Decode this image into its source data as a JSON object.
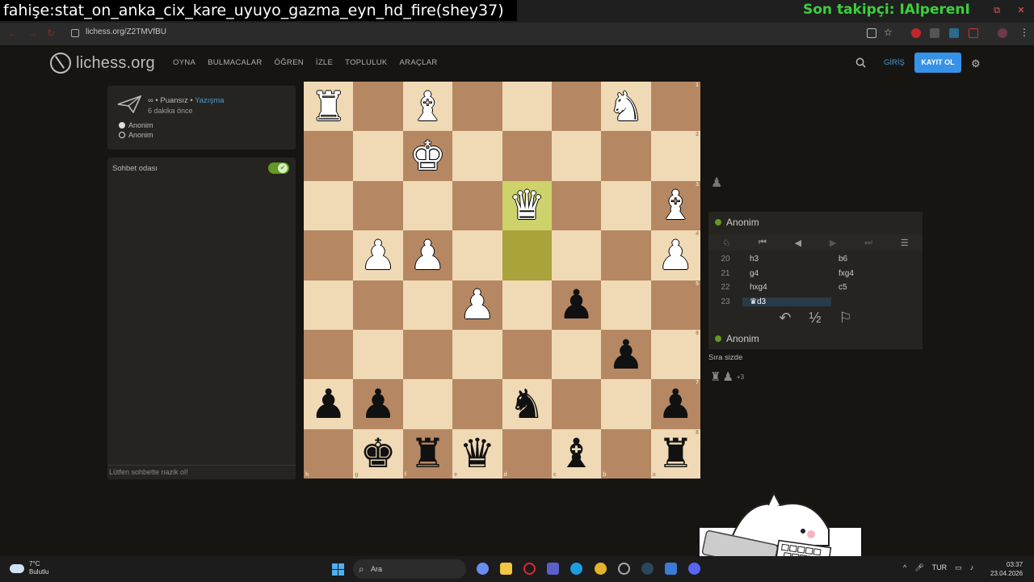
{
  "overlay": {
    "title": "fahişe:stat_on_anka_cix_kare_uyuyo_gazma_eyn_hd_fire(shey37)",
    "follower": "Son takipçi: IAlperenI"
  },
  "browser": {
    "url": "lichess.org/Z2TMVfBU"
  },
  "site": {
    "logo": "lichess.org",
    "nav": [
      "OYNA",
      "BULMACALAR",
      "ÖĞREN",
      "İZLE",
      "TOPLULUK",
      "ARAÇLAR"
    ],
    "login": "GİRİŞ",
    "register": "KAYIT OL"
  },
  "game_info": {
    "mode_prefix": "∞ • Puansız • ",
    "mode_link": "Yazışma",
    "time": "6 dakika önce",
    "players": [
      "Anonim",
      "Anonim"
    ]
  },
  "chat": {
    "title": "Sohbet odası",
    "placeholder": "Lütfen sohbette nazik ol!"
  },
  "board": {
    "ranks": [
      [
        {
          "p": "♜",
          "c": "white"
        },
        {
          "p": "",
          "c": ""
        },
        {
          "p": "♝",
          "c": "white"
        },
        {
          "p": "",
          "c": ""
        },
        {
          "p": "",
          "c": ""
        },
        {
          "p": "",
          "c": ""
        },
        {
          "p": "♞",
          "c": "white"
        },
        {
          "p": "",
          "c": ""
        }
      ],
      [
        {
          "p": "",
          "c": ""
        },
        {
          "p": "",
          "c": ""
        },
        {
          "p": "♚",
          "c": "white"
        },
        {
          "p": "",
          "c": ""
        },
        {
          "p": "",
          "c": ""
        },
        {
          "p": "",
          "c": ""
        },
        {
          "p": "",
          "c": ""
        },
        {
          "p": "",
          "c": ""
        }
      ],
      [
        {
          "p": "",
          "c": ""
        },
        {
          "p": "",
          "c": ""
        },
        {
          "p": "",
          "c": ""
        },
        {
          "p": "",
          "c": ""
        },
        {
          "p": "♛",
          "c": "white",
          "hl": "hl"
        },
        {
          "p": "",
          "c": ""
        },
        {
          "p": "",
          "c": ""
        },
        {
          "p": "♝",
          "c": "white"
        }
      ],
      [
        {
          "p": "",
          "c": ""
        },
        {
          "p": "♟",
          "c": "white"
        },
        {
          "p": "♟",
          "c": "white"
        },
        {
          "p": "",
          "c": ""
        },
        {
          "p": "",
          "c": "",
          "hl": "hl2"
        },
        {
          "p": "",
          "c": ""
        },
        {
          "p": "",
          "c": ""
        },
        {
          "p": "♟",
          "c": "white"
        }
      ],
      [
        {
          "p": "",
          "c": ""
        },
        {
          "p": "",
          "c": ""
        },
        {
          "p": "",
          "c": ""
        },
        {
          "p": "♟",
          "c": "white"
        },
        {
          "p": "",
          "c": ""
        },
        {
          "p": "♟",
          "c": "black"
        },
        {
          "p": "",
          "c": ""
        },
        {
          "p": "",
          "c": ""
        }
      ],
      [
        {
          "p": "",
          "c": ""
        },
        {
          "p": "",
          "c": ""
        },
        {
          "p": "",
          "c": ""
        },
        {
          "p": "",
          "c": ""
        },
        {
          "p": "",
          "c": ""
        },
        {
          "p": "",
          "c": ""
        },
        {
          "p": "♟",
          "c": "black"
        },
        {
          "p": "",
          "c": ""
        }
      ],
      [
        {
          "p": "♟",
          "c": "black"
        },
        {
          "p": "♟",
          "c": "black"
        },
        {
          "p": "",
          "c": ""
        },
        {
          "p": "",
          "c": ""
        },
        {
          "p": "♞",
          "c": "black"
        },
        {
          "p": "",
          "c": ""
        },
        {
          "p": "",
          "c": ""
        },
        {
          "p": "♟",
          "c": "black"
        }
      ],
      [
        {
          "p": "",
          "c": ""
        },
        {
          "p": "♚",
          "c": "black"
        },
        {
          "p": "♜",
          "c": "black"
        },
        {
          "p": "♛",
          "c": "black"
        },
        {
          "p": "",
          "c": ""
        },
        {
          "p": "♝",
          "c": "black"
        },
        {
          "p": "",
          "c": ""
        },
        {
          "p": "♜",
          "c": "black"
        }
      ]
    ],
    "rank_labels": [
      "1",
      "2",
      "3",
      "4",
      "5",
      "6",
      "7",
      "8"
    ],
    "file_labels": [
      "h",
      "g",
      "f",
      "e",
      "d",
      "c",
      "b",
      "a"
    ]
  },
  "right_panel": {
    "top_player": "Anonim",
    "bottom_player": "Anonim",
    "moves": [
      {
        "no": "20",
        "w": "h3",
        "b": "b6"
      },
      {
        "no": "21",
        "w": "g4",
        "b": "fxg4"
      },
      {
        "no": "22",
        "w": "hxg4",
        "b": "c5"
      },
      {
        "no": "23",
        "w": "♛d3",
        "b": ""
      }
    ],
    "draw_label": "½",
    "turn_text": "Sıra sizde",
    "captured_plus": "+3"
  },
  "taskbar": {
    "temp": "7°C",
    "weather": "Bulutlu",
    "search": "Ara",
    "lang": "TUR",
    "time": "03:37",
    "date": "23.04.2026"
  }
}
